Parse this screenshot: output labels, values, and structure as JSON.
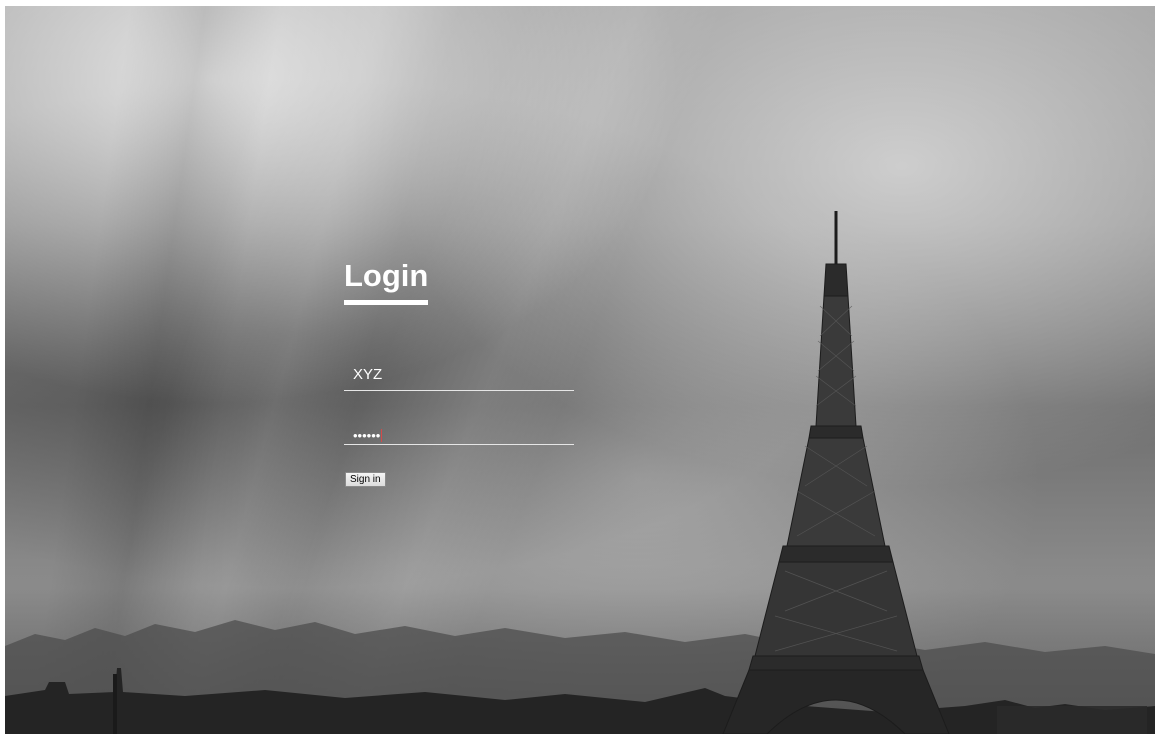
{
  "login": {
    "title": "Login",
    "username_value": "XYZ",
    "password_mask": "••••••",
    "signin_label": "Sign in"
  },
  "background": {
    "subject": "eiffel-tower-cityscape",
    "tone": "grayscale"
  }
}
